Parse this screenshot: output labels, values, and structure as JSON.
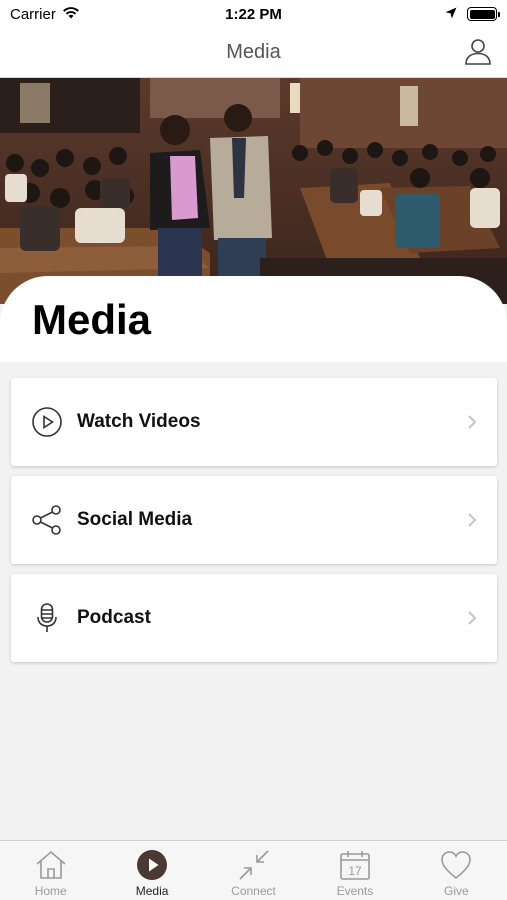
{
  "status_bar": {
    "carrier": "Carrier",
    "time": "1:22 PM"
  },
  "nav": {
    "title": "Media"
  },
  "hero": {
    "title": "Media"
  },
  "menu": {
    "items": [
      {
        "label": "Watch Videos",
        "icon": "play-circle-icon"
      },
      {
        "label": "Social Media",
        "icon": "share-icon"
      },
      {
        "label": "Podcast",
        "icon": "microphone-icon"
      }
    ]
  },
  "tabs": [
    {
      "label": "Home",
      "icon": "home-icon",
      "active": false
    },
    {
      "label": "Media",
      "icon": "play-icon",
      "active": true
    },
    {
      "label": "Connect",
      "icon": "connect-icon",
      "active": false
    },
    {
      "label": "Events",
      "icon": "calendar-icon",
      "active": false,
      "calendar_day": "17"
    },
    {
      "label": "Give",
      "icon": "heart-icon",
      "active": false
    }
  ],
  "colors": {
    "accent": "#4a3a33",
    "inactive": "#9a9a9a",
    "background": "#f2f2f2"
  }
}
